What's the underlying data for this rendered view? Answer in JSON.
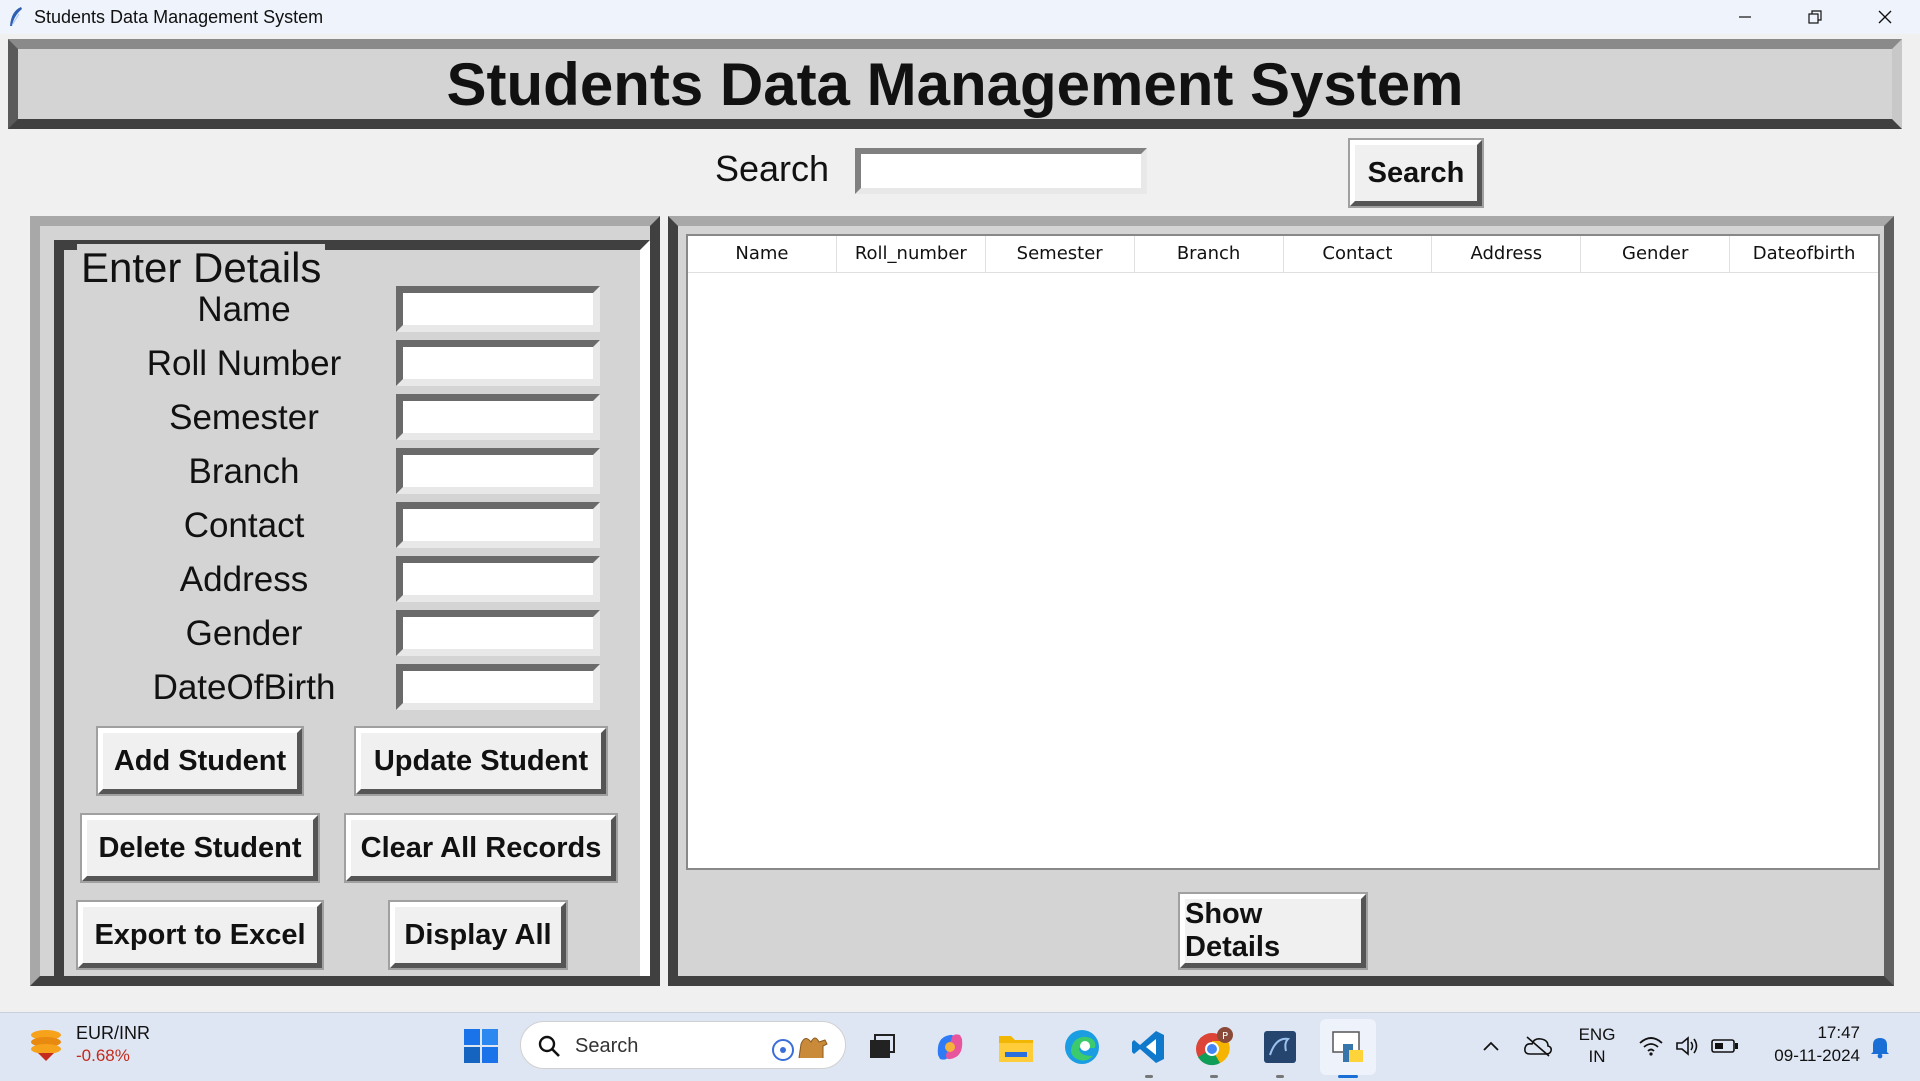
{
  "window": {
    "title": "Students Data Management System"
  },
  "header": {
    "title": "Students Data Management System"
  },
  "search": {
    "label": "Search",
    "value": "",
    "button_label": "Search"
  },
  "details": {
    "legend": "Enter Details",
    "fields": [
      {
        "label": "Name",
        "value": ""
      },
      {
        "label": "Roll Number",
        "value": ""
      },
      {
        "label": "Semester",
        "value": ""
      },
      {
        "label": "Branch",
        "value": ""
      },
      {
        "label": "Contact",
        "value": ""
      },
      {
        "label": "Address",
        "value": ""
      },
      {
        "label": "Gender",
        "value": ""
      },
      {
        "label": "DateOfBirth",
        "value": ""
      }
    ],
    "buttons": {
      "add": "Add Student",
      "update": "Update Student",
      "delete": "Delete Student",
      "clear": "Clear All Records",
      "export": "Export to Excel",
      "display": "Display All"
    }
  },
  "table": {
    "columns": [
      "Name",
      "Roll_number",
      "Semester",
      "Branch",
      "Contact",
      "Address",
      "Gender",
      "Dateofbirth"
    ],
    "rows": [],
    "show_button": "Show Details"
  },
  "taskbar": {
    "ticker": {
      "label": "EUR/INR",
      "value": "-0.68%",
      "value_color": "#c42b1c"
    },
    "search_placeholder": "Search",
    "language": {
      "line1": "ENG",
      "line2": "IN"
    },
    "time": "17:47",
    "date": "09-11-2024",
    "apps": [
      "windows-start",
      "task-view",
      "copilot",
      "file-explorer",
      "edge",
      "vscode",
      "chrome",
      "mysql-workbench",
      "python"
    ]
  }
}
